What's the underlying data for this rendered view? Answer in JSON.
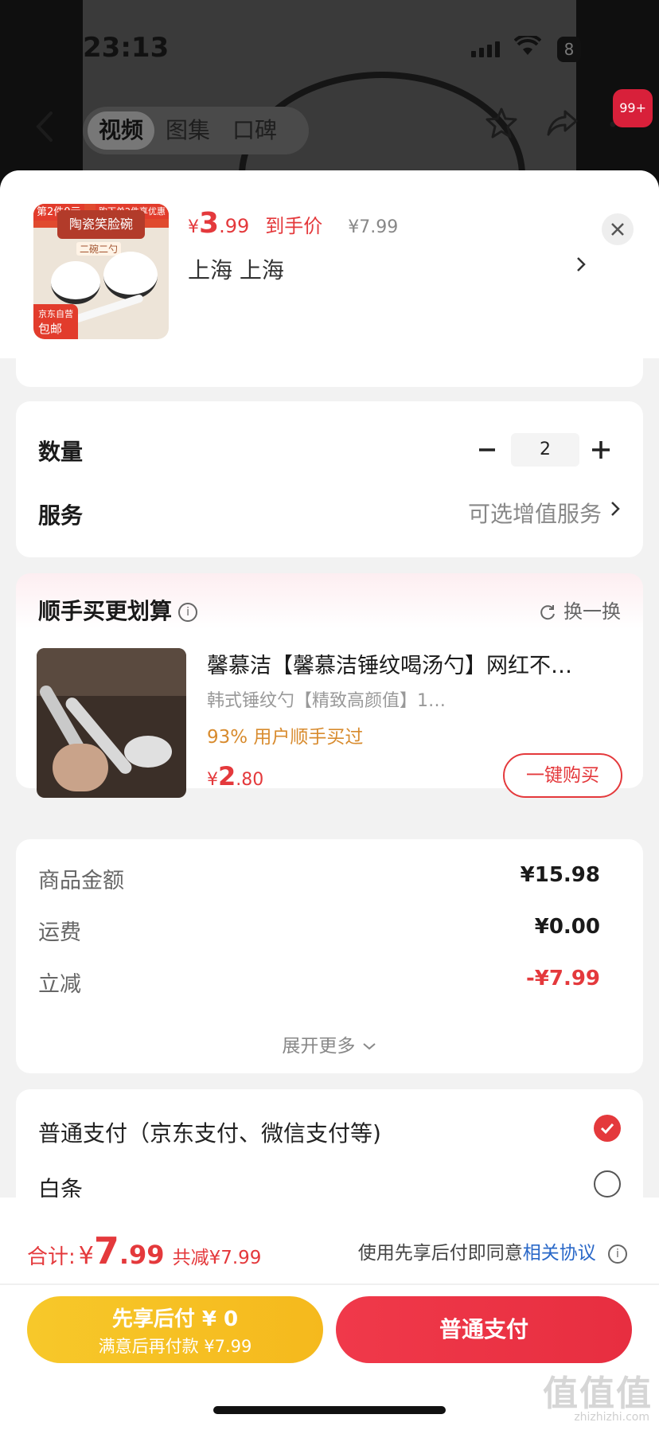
{
  "status_bar": {
    "time": "23:13",
    "battery": "8"
  },
  "nav": {
    "tabs": [
      {
        "label": "视频",
        "active": true
      },
      {
        "label": "图集",
        "active": false
      },
      {
        "label": "口碑",
        "active": false
      }
    ],
    "more_badge": "99+"
  },
  "product": {
    "thumb_tag_left": "第2件0元",
    "thumb_title": "陶瓷笑脸碗",
    "thumb_subtitle": "二碗二勺",
    "thumb_tag_right": "购下单2件享优惠",
    "thumb_bottom_line1": "京东自营",
    "thumb_bottom_line2": "包邮",
    "price_currency": "¥",
    "price_int": "3",
    "price_dec": ".99",
    "price_tag": "到手价",
    "price_original": "¥7.99",
    "address": "上海  上海"
  },
  "order": {
    "quantity_label": "数量",
    "quantity": "2",
    "service_label": "服务",
    "service_value": "可选增值服务"
  },
  "upsell": {
    "title": "顺手买更划算",
    "swap_label": "换一换",
    "name": "馨慕洁【馨慕洁锤纹喝汤勺】网红不…",
    "subtitle": "韩式锤纹勺【精致高颜值】1…",
    "percent_text": "93% 用户顺手买过",
    "price_currency": "¥",
    "price_int": "2",
    "price_dec": ".80",
    "buy_label": "一键购买"
  },
  "amounts": {
    "rows": [
      {
        "label": "商品金额",
        "value": "¥15.98"
      },
      {
        "label": "运费",
        "value": "¥0.00"
      },
      {
        "label": "立减",
        "value": "-¥7.99"
      }
    ],
    "expand_label": "展开更多"
  },
  "payment": {
    "options": [
      {
        "label": "普通支付（京东支付、微信支付等)",
        "selected": true
      },
      {
        "label": "白条",
        "selected": false
      }
    ]
  },
  "footer": {
    "total_label": "合计:",
    "total_currency": "¥",
    "total_int": "7",
    "total_dec": ".99",
    "total_saved": "共减¥7.99",
    "agree_text": "使用先享后付即同意",
    "agree_link": "相关协议",
    "pay_later_line1": "先享后付 ¥ 0",
    "pay_later_line2": "满意后再付款 ¥7.99",
    "pay_normal_label": "普通支付",
    "watermark": "值值值",
    "watermark_sub": "zhizhizhi.com"
  },
  "colors": {
    "accent_red": "#e4393c",
    "pay_later_yellow": "#f7c82a",
    "link_blue": "#2a68c8",
    "upsell_orange": "#d88b2e"
  },
  "icons": [
    "back-arrow-icon",
    "star-icon",
    "share-icon",
    "more-icon",
    "close-icon",
    "chevron-right-icon",
    "minus-icon",
    "plus-icon",
    "info-icon",
    "refresh-icon",
    "chevron-down-icon",
    "checkmark-icon",
    "radio-empty-icon"
  ]
}
